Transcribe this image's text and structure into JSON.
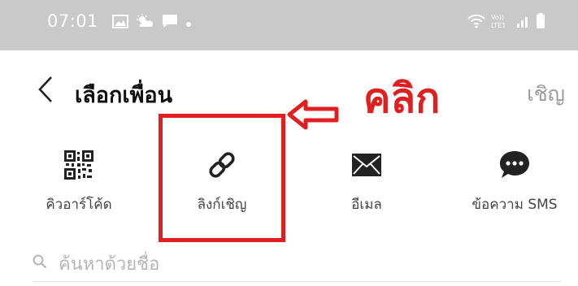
{
  "status_bar": {
    "time": "07:01",
    "left_icons": [
      "gallery-icon",
      "weather-icon",
      "message-icon",
      "dot-icon"
    ],
    "right_icons": [
      "wifi-icon",
      "volte-icon",
      "signal-icon",
      "battery-icon"
    ],
    "volte_text": "Vo)) LTE1",
    "background": "#c9c9c9"
  },
  "header": {
    "back_icon": "chevron-left-icon",
    "title": "เลือกเพื่อน",
    "invite_label": "เชิญ"
  },
  "annotation": {
    "label": "คลิก",
    "color": "#e02020"
  },
  "options": [
    {
      "icon": "qr-code-icon",
      "label": "คิวอาร์โค้ด"
    },
    {
      "icon": "link-icon",
      "label": "ลิงก์เชิญ"
    },
    {
      "icon": "email-icon",
      "label": "อีเมล"
    },
    {
      "icon": "sms-icon",
      "label": "ข้อความ SMS"
    }
  ],
  "search": {
    "icon": "search-icon",
    "placeholder": "ค้นหาด้วยชื่อ"
  }
}
